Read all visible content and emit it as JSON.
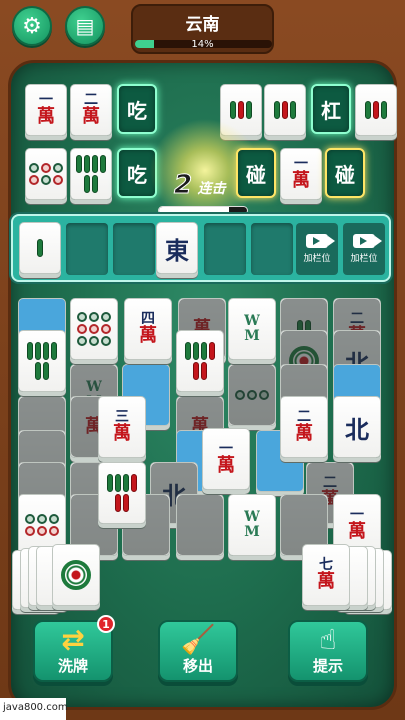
{
  "header": {
    "level_title": "云南",
    "progress_text": "14%",
    "progress": 0.14,
    "settings_icon": "gear-icon",
    "tasks_icon": "clipboard-icon"
  },
  "actions": {
    "chi_top": "吃",
    "gang": "杠",
    "chi_mid": "吃",
    "peng_1": "碰",
    "peng_2": "碰"
  },
  "melds": {
    "wan_one": "一",
    "wan_two": "二",
    "wan_char": "萬"
  },
  "combo": {
    "count": "2",
    "label": "连击",
    "timer_fraction": 0.8
  },
  "slot_bar": {
    "wind_tile": "東",
    "add_slot_label_1": "加栏位",
    "add_slot_label_2": "加栏位"
  },
  "board": {
    "wan": "萬",
    "four": "四",
    "three": "三",
    "two": "二",
    "one": "一",
    "seven": "七",
    "north": "北"
  },
  "buttons": {
    "shuffle": "洗牌",
    "shuffle_badge": "1",
    "remove": "移出",
    "hint": "提示"
  },
  "watermark": "java800.com"
}
